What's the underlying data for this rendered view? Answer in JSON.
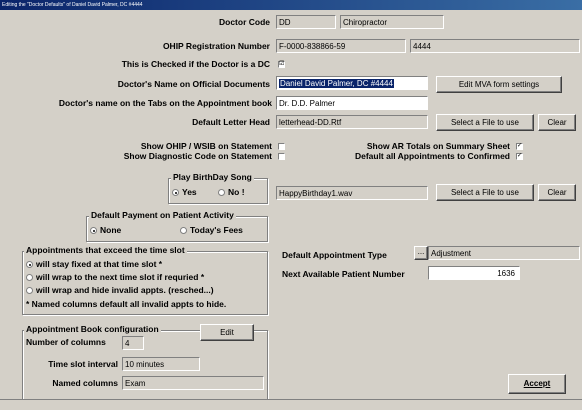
{
  "window": {
    "title": "Editing the \"Doctor Defaults\" of Daniel David Palmer, DC #4444"
  },
  "doctor_code": {
    "label": "Doctor Code",
    "value": "DD",
    "specialty": "Chiropractor"
  },
  "ohip": {
    "label": "OHIP Registration Number",
    "value": "F-0000-838866-59",
    "extra": "4444"
  },
  "is_dc": {
    "label": "This is Checked if the Doctor is a DC",
    "checked": "☑"
  },
  "official_name": {
    "label": "Doctor's Name on Official Documents",
    "value": "Daniel David Palmer, DC #4444",
    "mva_button": "Edit MVA form settings"
  },
  "tab_name": {
    "label": "Doctor's name on the Tabs on the Appointment book",
    "value": "Dr. D.D. Palmer"
  },
  "letterhead": {
    "label": "Default Letter Head",
    "value": "letterhead-DD.Rtf",
    "select_button": "Select a File to use",
    "clear_button": "Clear"
  },
  "statement": {
    "show_ohip_label": "Show OHIP / WSIB on Statement",
    "show_diag_label": "Show Diagnostic Code on Statement",
    "show_ar_label": "Show AR Totals on Summary Sheet",
    "default_confirmed_label": "Default all Appointments to Confirmed",
    "show_ohip": "",
    "show_diag": "",
    "show_ar": "✓",
    "default_confirmed": "✓"
  },
  "birthday": {
    "title": "Play BirthDay Song",
    "yes": "Yes",
    "no": "No !",
    "file": "HappyBirthday1.wav",
    "select_button": "Select a File to use",
    "clear_button": "Clear"
  },
  "payment": {
    "title": "Default Payment on Patient Activity",
    "none": "None",
    "today": "Today's Fees"
  },
  "exceed": {
    "title": "Appointments that exceed the time slot",
    "opt1": "will stay fixed at that time slot *",
    "opt2": "will wrap to the next time slot if requried *",
    "opt3": "will wrap and hide invalid appts. (resched...)",
    "note": "* Named columns default all invalid appts to hide."
  },
  "appt_type": {
    "label": "Default Appointment Type",
    "button": "...",
    "value": "Adjustment"
  },
  "next_patient": {
    "label": "Next Available Patient Number",
    "value": "1636"
  },
  "apptbook": {
    "title": "Appointment Book configuration",
    "edit_button": "Edit",
    "columns_label": "Number of columns",
    "columns_value": "4",
    "interval_label": "Time slot interval",
    "interval_value": "10 minutes",
    "named_label": "Named columns",
    "named_value": "Exam"
  },
  "accept_button": "Accept"
}
